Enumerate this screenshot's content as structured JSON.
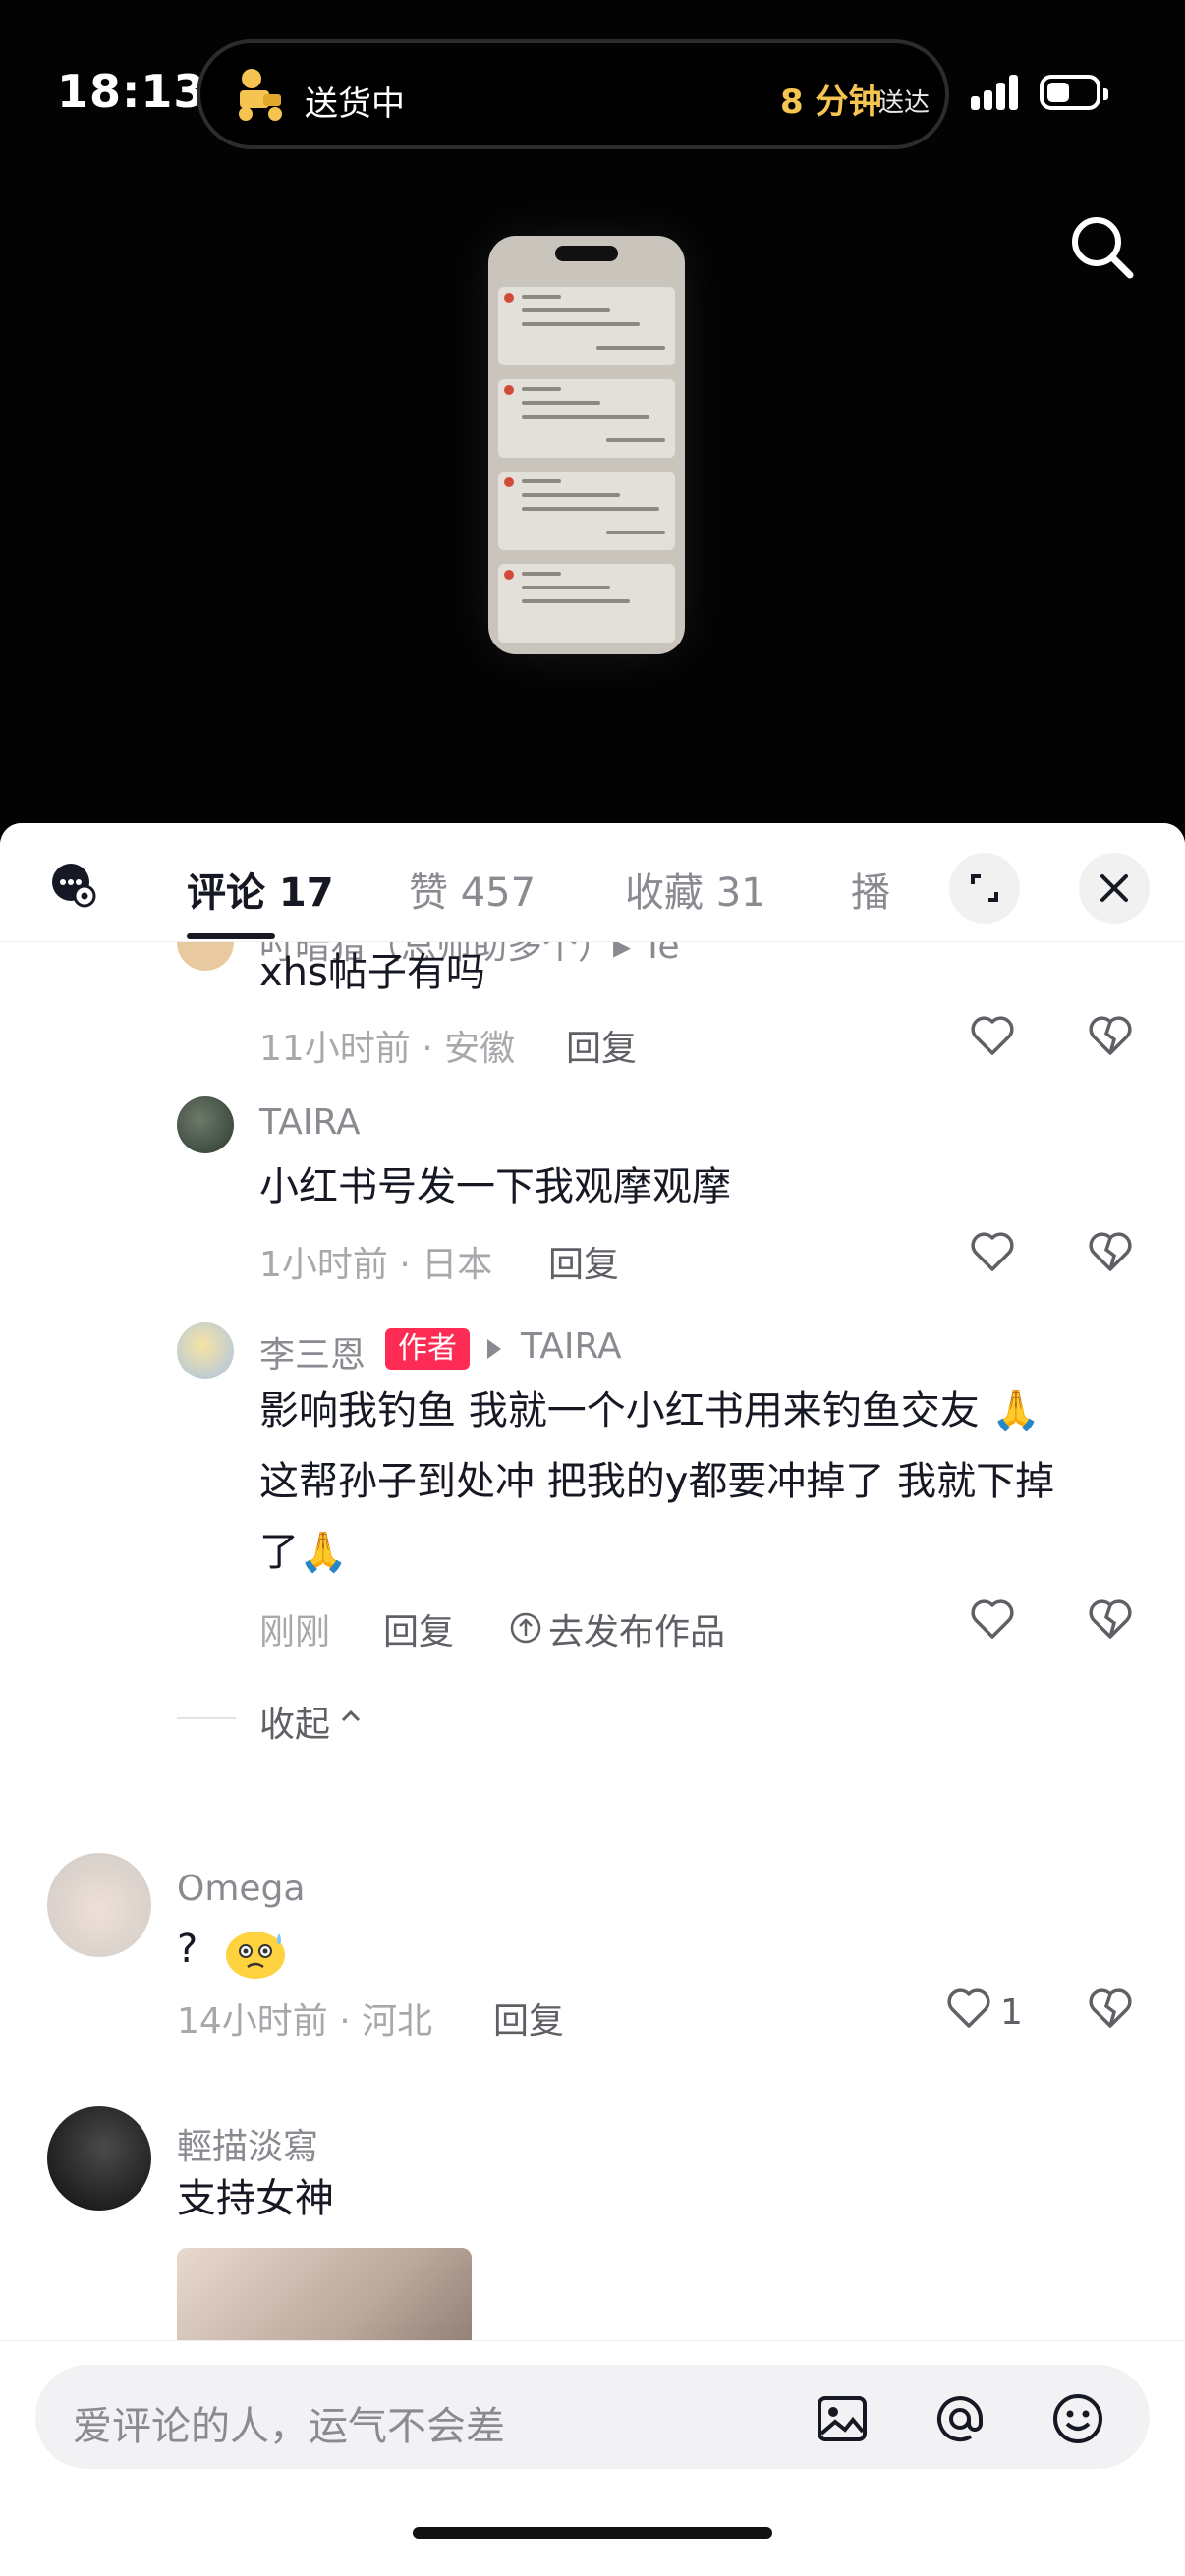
{
  "status_bar": {
    "time": "18:13",
    "delivery_status": "送货中",
    "eta_value": "8 分钟",
    "eta_suffix": "送达"
  },
  "tabs": {
    "comments": "评论 17",
    "likes": "赞 457",
    "favorites": "收藏 31",
    "broadcast": "播"
  },
  "comments": {
    "partial_top_name": "吋暗猎（总师助多个）▸ Te",
    "c1": {
      "text": "xhs帖子有吗",
      "meta": "11小时前 · 安徽",
      "reply": "回复"
    },
    "c2": {
      "user": "TAIRA",
      "text": "小红书号发一下我观摩观摩",
      "meta": "1小时前 · 日本",
      "reply": "回复"
    },
    "c3": {
      "user": "李三恩",
      "badge": "作者",
      "reply_to": "TAIRA",
      "line1": "影响我钓鱼 我就一个小红书用来钓鱼交友 🙏",
      "line2": "这帮孙子到处冲 把我的y都要冲掉了 我就下掉",
      "line3": "了🙏",
      "meta": "刚刚",
      "reply": "回复",
      "publish": "去发布作品"
    },
    "collapse": "收起",
    "c4": {
      "user": "Omega",
      "text": "?",
      "meta": "14小时前 · 河北",
      "reply": "回复",
      "like_count": "1"
    },
    "c5": {
      "user": "輕描淡寫",
      "text": "支持女神"
    }
  },
  "input": {
    "placeholder": "爱评论的人，运气不会差"
  },
  "icons": [
    "search-icon",
    "comment-settings-icon",
    "expand-icon",
    "close-icon",
    "heart-icon",
    "dislike-icon",
    "upload-icon",
    "chevron-up-icon",
    "image-icon",
    "at-icon",
    "emoji-icon"
  ],
  "colors": {
    "author_badge": "#fe2c55",
    "eta": "#f5c451"
  }
}
